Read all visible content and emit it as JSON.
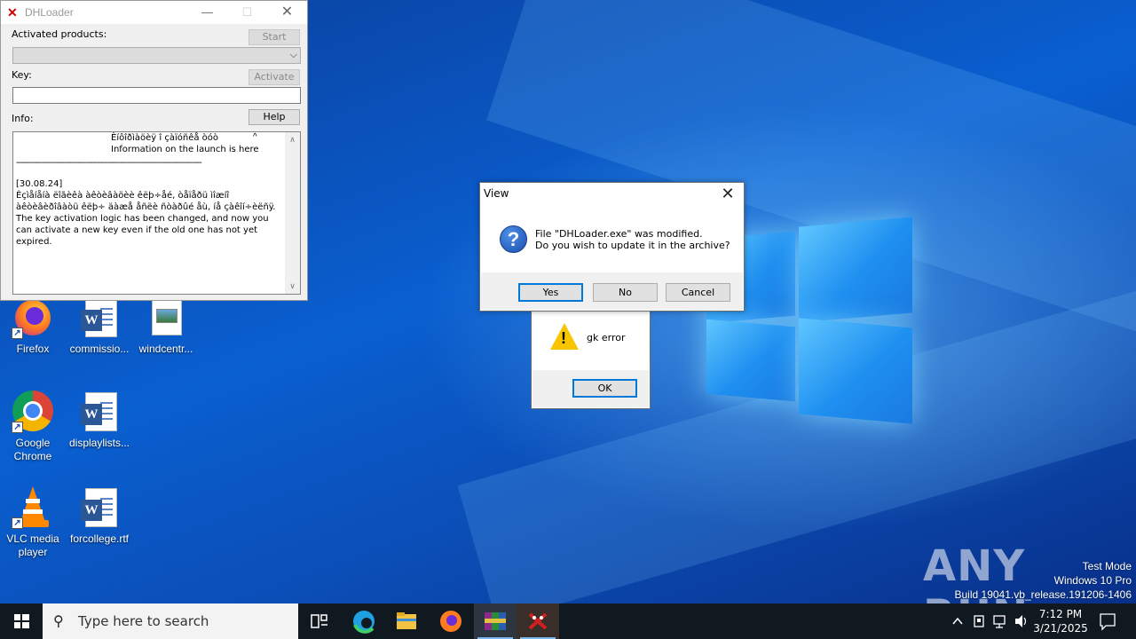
{
  "dhloader": {
    "title": "DHLoader",
    "activated_label": "Activated products:",
    "start_label": "Start",
    "key_label": "Key:",
    "activate_label": "Activate",
    "info_label": "Info:",
    "help_label": "Help",
    "info_line1": "Èíôîðìàöèÿ î çàïóñêå òóò",
    "info_line2": "Information on the launch is here",
    "info_date": "[30.08.24]",
    "info_text1": "Èçìåíåíà ëîãèêà àêòèâàöèè êëþ÷åé, òåïåðü ìîæíî àêòèâèðîâàòü êëþ÷ äàæå åñëè ñòàðûé åù, íå çàêîí÷èëñÿ.",
    "info_text2": "The key activation logic has been changed, and now you can activate a new key even if the old one has not yet expired."
  },
  "view_dialog": {
    "title": "View",
    "message_line1": "File \"DHLoader.exe\" was modified.",
    "message_line2": "Do you wish to update it in the archive?",
    "yes_label": "Yes",
    "no_label": "No",
    "cancel_label": "Cancel"
  },
  "gk_dialog": {
    "message": "gk error",
    "ok_label": "OK"
  },
  "desktop_icons": [
    {
      "label": "Firefox"
    },
    {
      "label": "commissio..."
    },
    {
      "label": "windcentr..."
    },
    {
      "label": "Google Chrome"
    },
    {
      "label": "displaylists..."
    },
    {
      "label": "VLC media player"
    },
    {
      "label": "forcollege.rtf"
    }
  ],
  "watermark": {
    "line1": "Test Mode",
    "line2": "Windows 10 Pro",
    "line3": "Build 19041.vb_release.191206-1406",
    "brand": "ANY RUN"
  },
  "taskbar": {
    "search_placeholder": "Type here to search",
    "time": "7:12 PM",
    "date": "3/21/2025"
  },
  "colors": {
    "desktop_blue": "#0a4fb0",
    "taskbar": "#101820",
    "accent": "#0078d7",
    "warning_yellow": "#f7c600"
  }
}
